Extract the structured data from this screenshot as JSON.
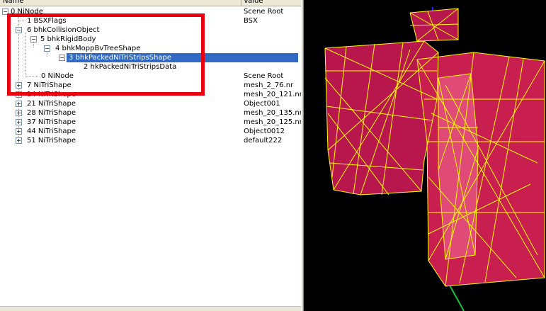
{
  "header": {
    "name": "Name",
    "value": "Value"
  },
  "tree": [
    {
      "label": "0 NiNode",
      "value": "Scene Root",
      "expand": "minus"
    },
    {
      "label": "1 BSXFlags",
      "value": "BSX",
      "expand": ""
    },
    {
      "label": "6 bhkCollisionObject",
      "value": "",
      "expand": "minus"
    },
    {
      "label": "5 bhkRigidBody",
      "value": "",
      "expand": "minus"
    },
    {
      "label": "4 bhkMoppBvTreeShape",
      "value": "",
      "expand": "minus"
    },
    {
      "label": "3 bhkPackedNiTriStripsShape",
      "value": "",
      "expand": "minus",
      "selected": true
    },
    {
      "label": "2 hkPackedNiTriStripsData",
      "value": "",
      "expand": ""
    },
    {
      "label": "0 NiNode",
      "value": "Scene Root",
      "expand": ""
    },
    {
      "label": "7 NiTriShape",
      "value": "mesh_2_76.nr",
      "expand": "plus"
    },
    {
      "label": "14 NiTriShape",
      "value": "mesh_20_121.nr",
      "expand": "plus"
    },
    {
      "label": "21 NiTriShape",
      "value": "Object001",
      "expand": "plus"
    },
    {
      "label": "28 NiTriShape",
      "value": "mesh_20_135.nr",
      "expand": "plus"
    },
    {
      "label": "37 NiTriShape",
      "value": "mesh_20_125.nr",
      "expand": "plus"
    },
    {
      "label": "44 NiTriShape",
      "value": "Object0012",
      "expand": "plus"
    },
    {
      "label": "51 NiTriShape",
      "value": "default222",
      "expand": "plus"
    }
  ],
  "colors": {
    "selection": "#316ac5",
    "highlight_box": "#e8000e",
    "wireframe": "#ffff00",
    "mesh": "#c81e50",
    "viewport_bg": "#000000"
  }
}
